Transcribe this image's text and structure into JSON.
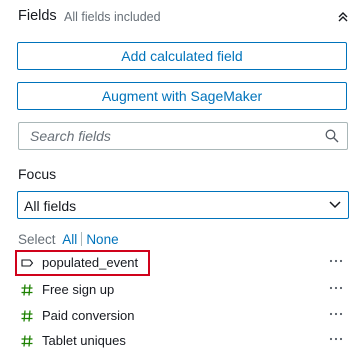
{
  "header": {
    "title": "Fields",
    "subtitle": "All fields included"
  },
  "buttons": {
    "calculated_field": "Add calculated field",
    "sagemaker": "Augment with SageMaker"
  },
  "search": {
    "placeholder": "Search fields",
    "value": ""
  },
  "focus": {
    "label": "Focus",
    "selected": "All fields"
  },
  "select": {
    "label": "Select",
    "all": "All",
    "none": "None"
  },
  "fields": [
    {
      "name": "populated_event",
      "icon": "text-field-icon",
      "highlighted": true
    },
    {
      "name": "Free sign up",
      "icon": "hash-icon"
    },
    {
      "name": "Paid conversion",
      "icon": "hash-icon"
    },
    {
      "name": "Tablet uniques",
      "icon": "hash-icon"
    }
  ],
  "colors": {
    "accent": "#0073bb",
    "highlight": "#d0021b",
    "muted": "#687078"
  }
}
